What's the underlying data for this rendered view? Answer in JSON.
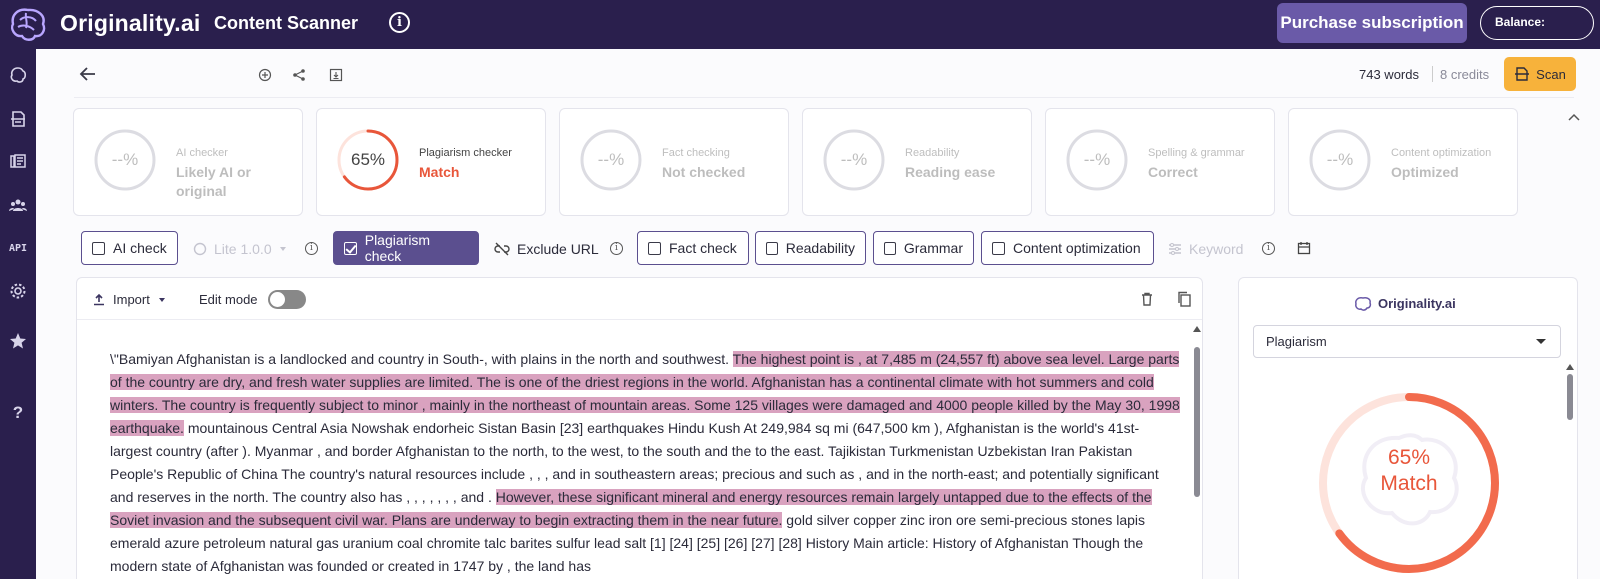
{
  "header": {
    "brand": "Originality.ai",
    "section_title": "Content Scanner",
    "info_glyph": "i",
    "purchase_label": "Purchase subscription",
    "balance_label": "Balance:"
  },
  "sidebar": {
    "items": [
      {
        "icon": "brain-icon"
      },
      {
        "icon": "document-scan-icon"
      },
      {
        "icon": "library-icon"
      },
      {
        "icon": "team-icon"
      },
      {
        "icon": "api-icon",
        "label": "API"
      },
      {
        "icon": "gear-icon"
      },
      {
        "icon": "star-icon"
      },
      {
        "icon": "help-icon",
        "label": "?"
      }
    ]
  },
  "toolbar": {
    "word_count": "743 words",
    "credits": "8 credits",
    "scan_label": "Scan"
  },
  "cards": [
    {
      "ring": "--%",
      "label": "AI checker",
      "value": "Likely AI or original",
      "active": false
    },
    {
      "ring": "65%",
      "label": "Plagiarism checker",
      "value": "Match",
      "active": true,
      "score": 65
    },
    {
      "ring": "--%",
      "label": "Fact checking",
      "value": "Not checked",
      "active": false
    },
    {
      "ring": "--%",
      "label": "Readability",
      "value": "Reading ease",
      "active": false
    },
    {
      "ring": "--%",
      "label": "Spelling & grammar",
      "value": "Correct",
      "active": false
    },
    {
      "ring": "--%",
      "label": "Content optimization",
      "value": "Optimized",
      "active": false
    }
  ],
  "options": {
    "ai_check": "AI check",
    "model": "Lite 1.0.0",
    "plagiarism_check": "Plagiarism check",
    "exclude_url": "Exclude URL",
    "fact_check": "Fact check",
    "readability": "Readability",
    "grammar": "Grammar",
    "content_optimization": "Content optimization",
    "keyword": "Keyword"
  },
  "editor": {
    "import_label": "Import",
    "edit_mode_label": "Edit mode",
    "edit_mode_on": false,
    "segments": [
      {
        "text": "\\\"Bamiyan Afghanistan is a landlocked and country in South-, with plains in the north and southwest. ",
        "hl": false
      },
      {
        "text": "The highest point is , at 7,485 m (24,557 ft) above sea level. Large parts of the country are dry, and fresh water supplies are limited. ",
        "hl": true
      },
      {
        "text": " The is one of the driest regions in the world. ",
        "hl": true
      },
      {
        "text": " Afghanistan has a continental climate with hot summers and cold winters. ",
        "hl": true
      },
      {
        "text": " The country is frequently subject to minor , mainly in the northeast of mountain areas. ",
        "hl": true
      },
      {
        "text": " Some 125 villages were damaged and 4000 people killed by the May 30, 1998 earthquake.",
        "hl": true
      },
      {
        "text": "  mountainous Central Asia Nowshak endorheic Sistan Basin [23] earthquakes Hindu Kush At 249,984 sq mi (647,500 km ), Afghanistan is the world's 41st-largest country (after ).  Myanmar , and border Afghanistan to the north, to the west, to the south and the to the east.  Tajikistan Turkmenistan Uzbekistan Iran Pakistan People's Republic of China The country's natural resources include , , , and in southeastern areas; precious and such as , and in the north-east; and potentially significant and reserves in the north.  The country also has , , , , , , , and . ",
        "hl": false
      },
      {
        "text": " However, these significant mineral and energy resources remain largely untapped due to the effects of the Soviet invasion and the subsequent civil war. ",
        "hl": true
      },
      {
        "text": " Plans are underway to begin extracting them in the near future.",
        "hl": true
      },
      {
        "text": "  gold silver copper zinc iron ore semi-precious stones lapis emerald azure petroleum natural gas uranium coal chromite talc barites sulfur lead salt [1] [24] [25] [26] [27] [28] History Main article: History of Afghanistan Though the modern state of Afghanistan was founded or created in 1747 by , the land has",
        "hl": false
      }
    ]
  },
  "result_panel": {
    "brand": "Originality.ai",
    "selected_view": "Plagiarism",
    "percent": "65%",
    "label": "Match",
    "score": 65,
    "accent": "#e8563a"
  }
}
